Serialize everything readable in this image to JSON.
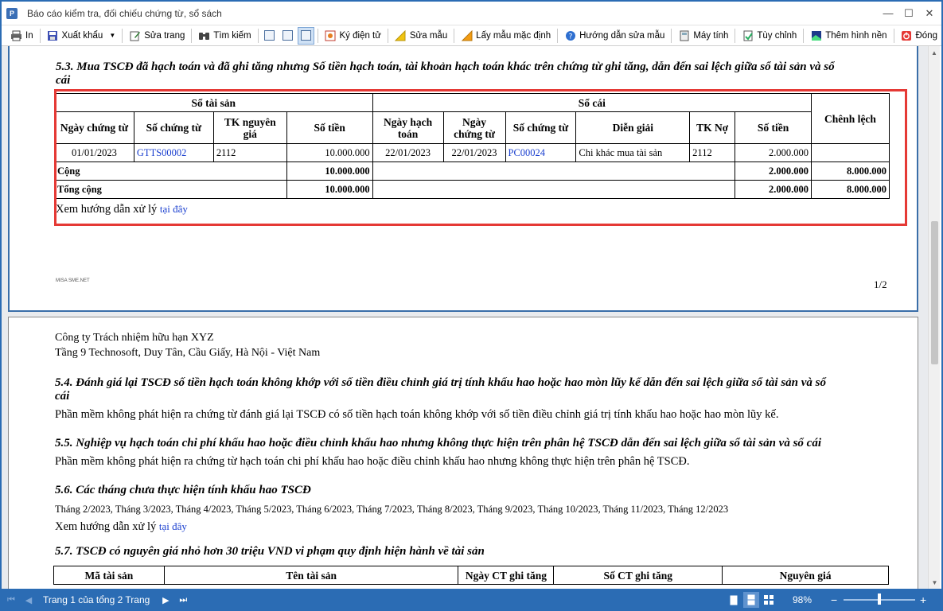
{
  "window": {
    "title": "Báo cáo kiểm tra, đối chiếu chứng từ, sổ sách",
    "minimize": "—",
    "maximize": "☐",
    "close": "✕"
  },
  "toolbar": {
    "print": "In",
    "export": "Xuất khẩu",
    "edit_page": "Sửa trang",
    "search": "Tìm kiếm",
    "e_sign": "Ký điện tử",
    "edit_template": "Sửa mẫu",
    "default_template": "Lấy mẫu mặc định",
    "help_edit": "Hướng dẫn sửa mẫu",
    "calculator": "Máy tính",
    "options": "Tùy chỉnh",
    "add_background": "Thêm hình nền",
    "close": "Đóng"
  },
  "page1": {
    "section_title_line1": "5.3. Mua TSCĐ đã hạch toán và đã ghi tăng nhưng Số tiền hạch toán, tài khoản hạch toán khác trên chứng từ ghi tăng, dẫn đến sai lệch giữa sổ tài sản và sổ",
    "section_title_line2": "cái",
    "table": {
      "group_asset": "Sổ tài sản",
      "group_ledger": "Sổ cái",
      "diff": "Chênh lệch",
      "headers": {
        "voucher_date": "Ngày chứng từ",
        "voucher_no": "Số chứng từ",
        "tk_cost_1": "TK nguyên",
        "tk_cost_2": "giá",
        "amount": "Số tiền",
        "post_date_1": "Ngày hạch",
        "post_date_2": "toán",
        "vdate_1": "Ngày",
        "vdate_2": "chứng từ",
        "voucher_no2": "Số chứng từ",
        "desc": "Diễn giải",
        "tk_debit": "TK Nợ",
        "amount2": "Số tiền"
      },
      "row": {
        "voucher_date": "01/01/2023",
        "voucher_no": "GTTS00002",
        "tk": "2112",
        "amount": "10.000.000",
        "post_date": "22/01/2023",
        "vdate": "22/01/2023",
        "voucher_no2": "PC00024",
        "desc": "Chi khác mua tài sản",
        "tk_debit": "2112",
        "amount2": "2.000.000"
      },
      "subtotal": {
        "label": "Cộng",
        "amount": "10.000.000",
        "amount2": "2.000.000",
        "diff": "8.000.000"
      },
      "total": {
        "label": "Tổng cộng",
        "amount": "10.000.000",
        "amount2": "2.000.000",
        "diff": "8.000.000"
      }
    },
    "guide_text": "Xem hướng dẫn xử lý",
    "guide_link": "tại đây",
    "footer_brand": "MISA SME.NET",
    "page_number": "1/2"
  },
  "page2": {
    "company": "Công ty Trách nhiệm hữu hạn XYZ",
    "address": "Tầng 9 Technosoft, Duy Tân, Cầu Giấy, Hà Nội - Việt Nam",
    "s54_title_line1": "5.4. Đánh giá lại TSCĐ số tiền hạch toán không khớp với số tiền điều chỉnh giá trị tính khấu hao hoặc hao mòn lũy kế dẫn đến sai lệch giữa sổ tài sản và sổ",
    "s54_title_line2": "cái",
    "s54_text": "Phần mềm không phát hiện ra chứng từ đánh giá lại TSCĐ có số tiền hạch toán không khớp với số tiền điều chỉnh giá trị tính khấu hao hoặc hao mòn lũy kế.",
    "s55_title": "5.5. Nghiệp vụ hạch toán chi phí khấu hao hoặc điều chỉnh khấu hao nhưng không thực hiện trên phân hệ TSCĐ dẫn đến sai lệch giữa sổ tài sản và sổ cái",
    "s55_text": "Phần mềm không phát hiện ra chứng từ hạch toán chi phí khấu hao hoặc điều chỉnh khấu hao nhưng không thực hiện trên phân hệ TSCĐ.",
    "s56_title": "5.6. Các tháng chưa thực hiện tính khấu hao TSCĐ",
    "s56_months": "Tháng 2/2023, Tháng 3/2023, Tháng 4/2023, Tháng 5/2023, Tháng 6/2023, Tháng 7/2023, Tháng 8/2023, Tháng 9/2023, Tháng 10/2023, Tháng 11/2023, Tháng 12/2023",
    "guide_text": "Xem hướng dẫn xử lý",
    "guide_link": "tại đây",
    "s57_title": "5.7. TSCĐ có nguyên giá nhỏ hơn 30 triệu VND vi phạm quy định hiện hành về tài sản",
    "s57_headers": {
      "code": "Mã tài sản",
      "name": "Tên tài sản",
      "date": "Ngày CT ghi tăng",
      "no": "Số CT ghi tăng",
      "cost": "Nguyên giá"
    }
  },
  "statusbar": {
    "page_info": "Trang 1 của tổng 2 Trang",
    "zoom": "98%",
    "zoom_minus": "−",
    "zoom_plus": "+"
  }
}
